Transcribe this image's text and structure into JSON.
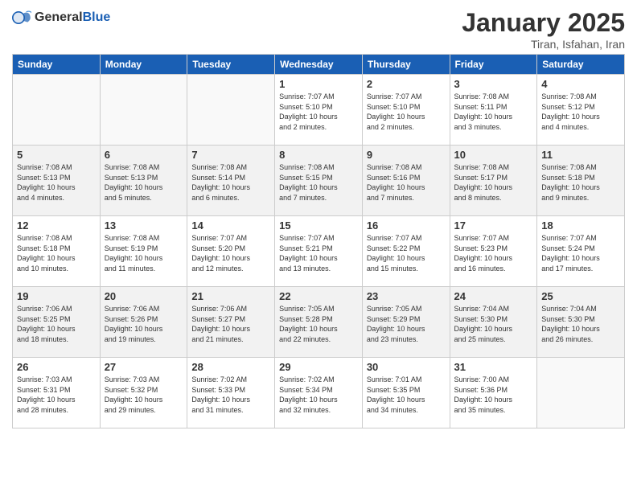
{
  "header": {
    "logo_general": "General",
    "logo_blue": "Blue",
    "month_title": "January 2025",
    "location": "Tiran, Isfahan, Iran"
  },
  "weekdays": [
    "Sunday",
    "Monday",
    "Tuesday",
    "Wednesday",
    "Thursday",
    "Friday",
    "Saturday"
  ],
  "weeks": [
    [
      {
        "day": "",
        "info": ""
      },
      {
        "day": "",
        "info": ""
      },
      {
        "day": "",
        "info": ""
      },
      {
        "day": "1",
        "info": "Sunrise: 7:07 AM\nSunset: 5:10 PM\nDaylight: 10 hours\nand 2 minutes."
      },
      {
        "day": "2",
        "info": "Sunrise: 7:07 AM\nSunset: 5:10 PM\nDaylight: 10 hours\nand 2 minutes."
      },
      {
        "day": "3",
        "info": "Sunrise: 7:08 AM\nSunset: 5:11 PM\nDaylight: 10 hours\nand 3 minutes."
      },
      {
        "day": "4",
        "info": "Sunrise: 7:08 AM\nSunset: 5:12 PM\nDaylight: 10 hours\nand 4 minutes."
      }
    ],
    [
      {
        "day": "5",
        "info": "Sunrise: 7:08 AM\nSunset: 5:13 PM\nDaylight: 10 hours\nand 4 minutes."
      },
      {
        "day": "6",
        "info": "Sunrise: 7:08 AM\nSunset: 5:13 PM\nDaylight: 10 hours\nand 5 minutes."
      },
      {
        "day": "7",
        "info": "Sunrise: 7:08 AM\nSunset: 5:14 PM\nDaylight: 10 hours\nand 6 minutes."
      },
      {
        "day": "8",
        "info": "Sunrise: 7:08 AM\nSunset: 5:15 PM\nDaylight: 10 hours\nand 7 minutes."
      },
      {
        "day": "9",
        "info": "Sunrise: 7:08 AM\nSunset: 5:16 PM\nDaylight: 10 hours\nand 7 minutes."
      },
      {
        "day": "10",
        "info": "Sunrise: 7:08 AM\nSunset: 5:17 PM\nDaylight: 10 hours\nand 8 minutes."
      },
      {
        "day": "11",
        "info": "Sunrise: 7:08 AM\nSunset: 5:18 PM\nDaylight: 10 hours\nand 9 minutes."
      }
    ],
    [
      {
        "day": "12",
        "info": "Sunrise: 7:08 AM\nSunset: 5:18 PM\nDaylight: 10 hours\nand 10 minutes."
      },
      {
        "day": "13",
        "info": "Sunrise: 7:08 AM\nSunset: 5:19 PM\nDaylight: 10 hours\nand 11 minutes."
      },
      {
        "day": "14",
        "info": "Sunrise: 7:07 AM\nSunset: 5:20 PM\nDaylight: 10 hours\nand 12 minutes."
      },
      {
        "day": "15",
        "info": "Sunrise: 7:07 AM\nSunset: 5:21 PM\nDaylight: 10 hours\nand 13 minutes."
      },
      {
        "day": "16",
        "info": "Sunrise: 7:07 AM\nSunset: 5:22 PM\nDaylight: 10 hours\nand 15 minutes."
      },
      {
        "day": "17",
        "info": "Sunrise: 7:07 AM\nSunset: 5:23 PM\nDaylight: 10 hours\nand 16 minutes."
      },
      {
        "day": "18",
        "info": "Sunrise: 7:07 AM\nSunset: 5:24 PM\nDaylight: 10 hours\nand 17 minutes."
      }
    ],
    [
      {
        "day": "19",
        "info": "Sunrise: 7:06 AM\nSunset: 5:25 PM\nDaylight: 10 hours\nand 18 minutes."
      },
      {
        "day": "20",
        "info": "Sunrise: 7:06 AM\nSunset: 5:26 PM\nDaylight: 10 hours\nand 19 minutes."
      },
      {
        "day": "21",
        "info": "Sunrise: 7:06 AM\nSunset: 5:27 PM\nDaylight: 10 hours\nand 21 minutes."
      },
      {
        "day": "22",
        "info": "Sunrise: 7:05 AM\nSunset: 5:28 PM\nDaylight: 10 hours\nand 22 minutes."
      },
      {
        "day": "23",
        "info": "Sunrise: 7:05 AM\nSunset: 5:29 PM\nDaylight: 10 hours\nand 23 minutes."
      },
      {
        "day": "24",
        "info": "Sunrise: 7:04 AM\nSunset: 5:30 PM\nDaylight: 10 hours\nand 25 minutes."
      },
      {
        "day": "25",
        "info": "Sunrise: 7:04 AM\nSunset: 5:30 PM\nDaylight: 10 hours\nand 26 minutes."
      }
    ],
    [
      {
        "day": "26",
        "info": "Sunrise: 7:03 AM\nSunset: 5:31 PM\nDaylight: 10 hours\nand 28 minutes."
      },
      {
        "day": "27",
        "info": "Sunrise: 7:03 AM\nSunset: 5:32 PM\nDaylight: 10 hours\nand 29 minutes."
      },
      {
        "day": "28",
        "info": "Sunrise: 7:02 AM\nSunset: 5:33 PM\nDaylight: 10 hours\nand 31 minutes."
      },
      {
        "day": "29",
        "info": "Sunrise: 7:02 AM\nSunset: 5:34 PM\nDaylight: 10 hours\nand 32 minutes."
      },
      {
        "day": "30",
        "info": "Sunrise: 7:01 AM\nSunset: 5:35 PM\nDaylight: 10 hours\nand 34 minutes."
      },
      {
        "day": "31",
        "info": "Sunrise: 7:00 AM\nSunset: 5:36 PM\nDaylight: 10 hours\nand 35 minutes."
      },
      {
        "day": "",
        "info": ""
      }
    ]
  ],
  "row_backgrounds": [
    "row-bg-1",
    "row-bg-2",
    "row-bg-1",
    "row-bg-2",
    "row-bg-1"
  ]
}
